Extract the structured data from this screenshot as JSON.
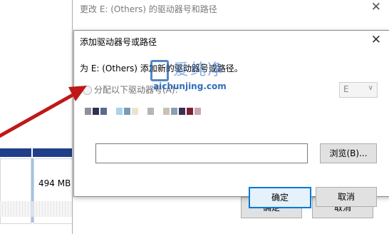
{
  "background": {
    "disk_size": "494 MB"
  },
  "outer_dialog": {
    "title": "更改 E: (Others) 的驱动器号和路径",
    "close_glyph": "✕",
    "ok_label": "确定",
    "cancel_label": "取消"
  },
  "dialog": {
    "title": "添加驱动器号或路径",
    "close_glyph": "✕",
    "prompt": "为 E: (Others) 添加新的驱动器号或路径。",
    "assign_label": "分配以下驱动器号(A):",
    "drive_letter": "E",
    "dropdown_glyph": "∨",
    "browse_label": "浏览(B)...",
    "ok_label": "确定",
    "cancel_label": "取消",
    "mosaic_colors": [
      "#8f8f98",
      "#2b3350",
      "#5a6a8a",
      "#ffffff",
      "#a9d4ea",
      "#7a9bb5",
      "#e9e4cf",
      "#ffffff",
      "#b5b5b5",
      "#ffffff",
      "#c9c2b4",
      "#8aa0b0",
      "#3a2f55",
      "#7a2235",
      "#c9a8b0"
    ]
  },
  "watermark": {
    "chinese": "爱纯净",
    "url": "aichunjing.com"
  },
  "colors": {
    "accent": "#0078d7",
    "arrow": "#c01818",
    "disk_bar": "#1f3f8a"
  }
}
